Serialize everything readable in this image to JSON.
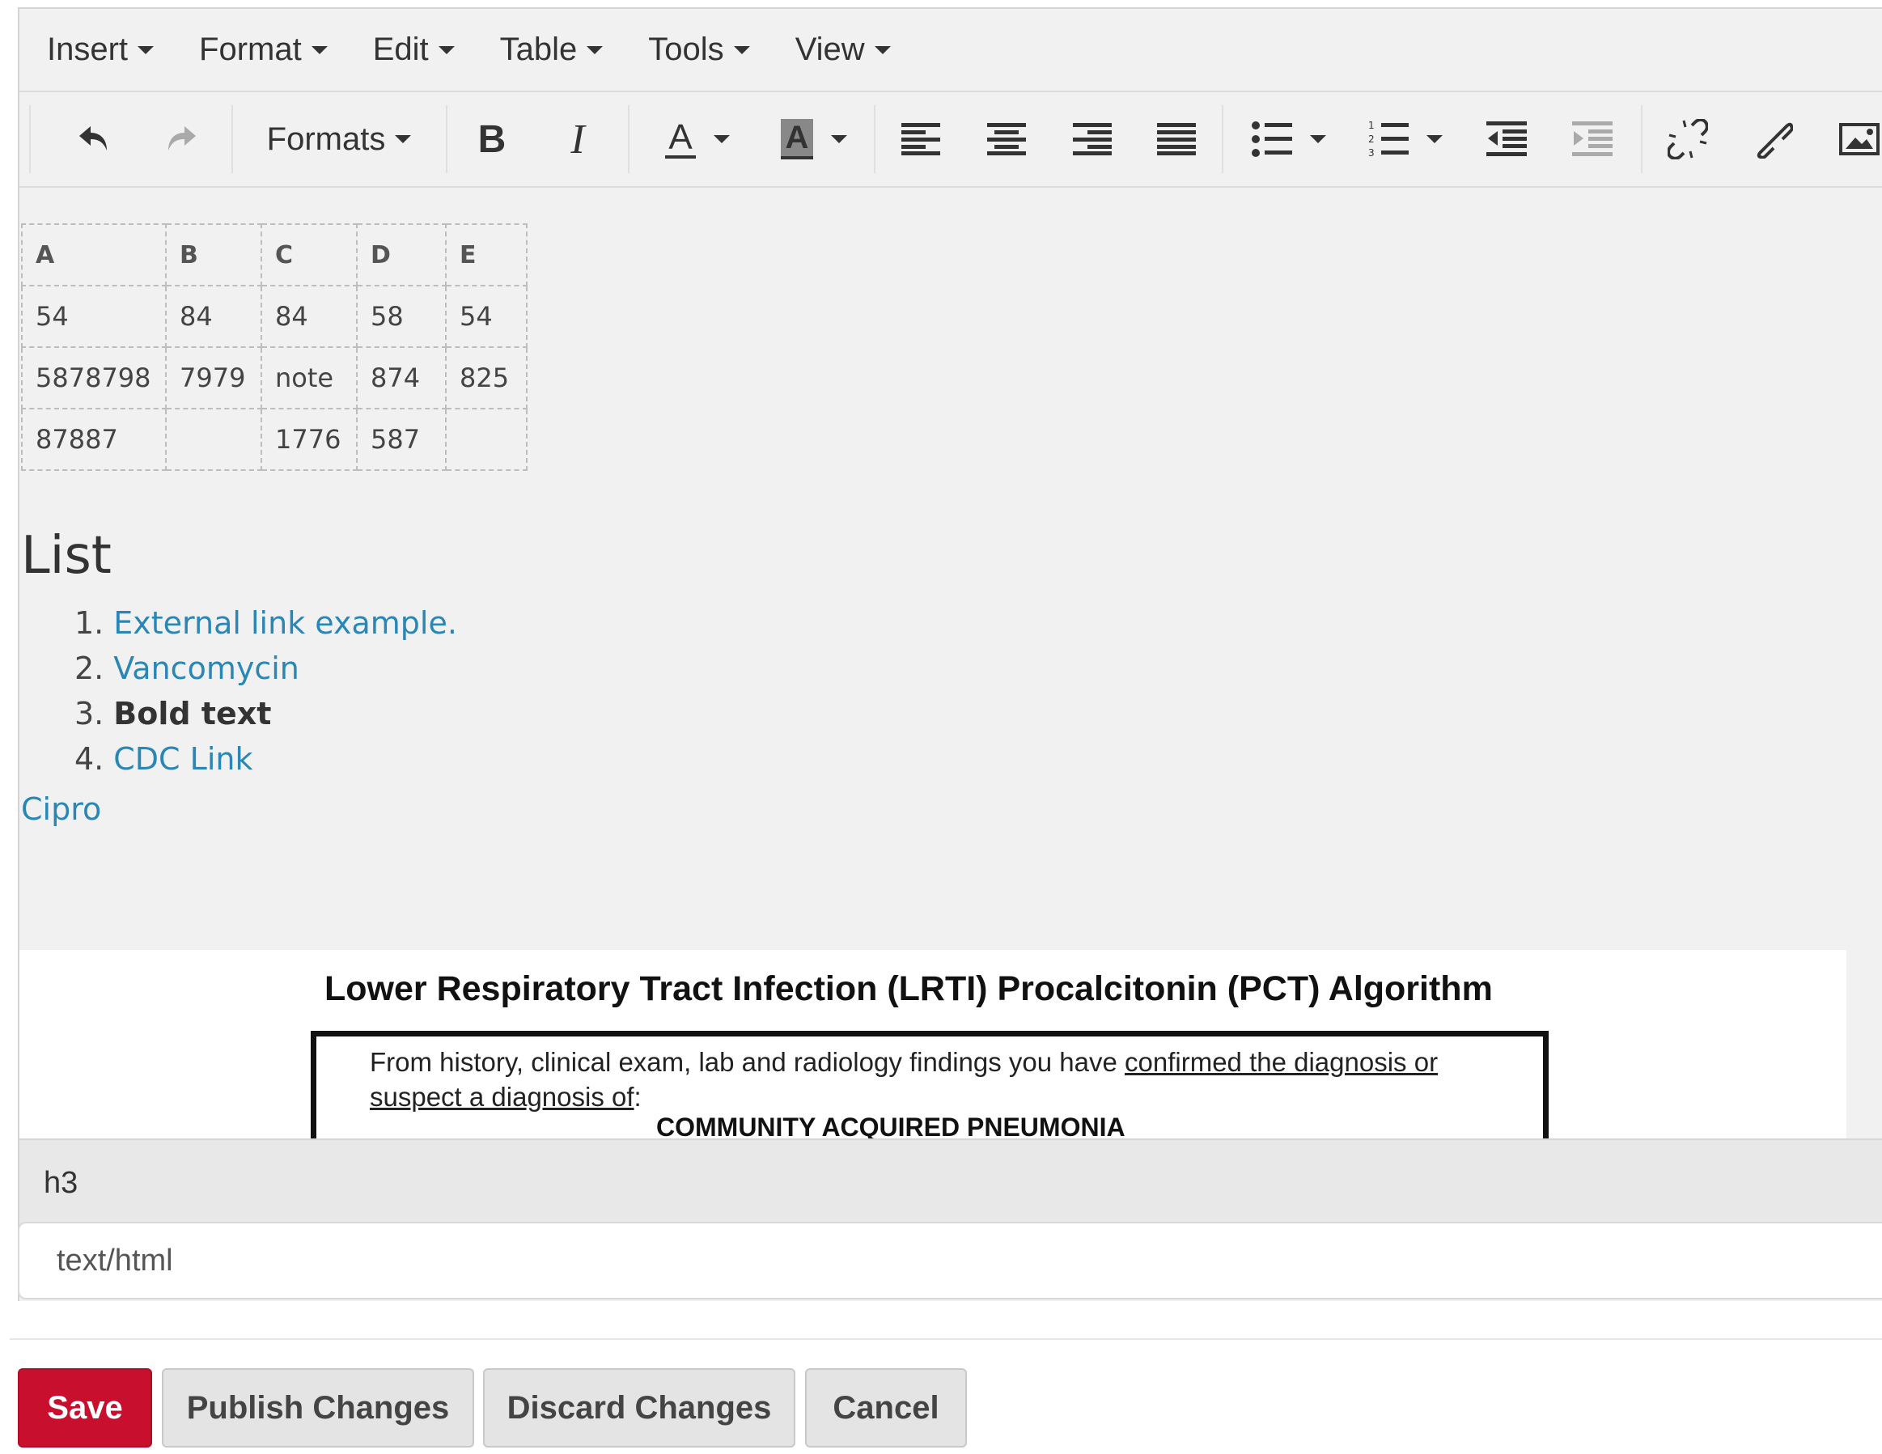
{
  "menubar": {
    "items": [
      {
        "label": "Insert"
      },
      {
        "label": "Format"
      },
      {
        "label": "Edit"
      },
      {
        "label": "Table"
      },
      {
        "label": "Tools"
      },
      {
        "label": "View"
      }
    ]
  },
  "toolbar": {
    "formats_label": "Formats",
    "bold_glyph": "B",
    "italic_glyph": "I",
    "text_color_glyph": "A",
    "bg_color_glyph": "A",
    "icons": [
      "undo-icon",
      "redo-icon",
      "bold-icon",
      "italic-icon",
      "text-color-icon",
      "background-color-icon",
      "align-left-icon",
      "align-center-icon",
      "align-right-icon",
      "align-justify-icon",
      "bullet-list-icon",
      "numbered-list-icon",
      "outdent-icon",
      "indent-icon",
      "unlink-icon",
      "link-icon",
      "image-icon"
    ]
  },
  "content": {
    "table": {
      "headers": [
        "A",
        "B",
        "C",
        "D",
        "E"
      ],
      "rows": [
        [
          "54",
          "84",
          "84",
          "58",
          "54"
        ],
        [
          "5878798",
          "7979",
          "note",
          "874",
          "825"
        ],
        [
          "87887",
          "",
          "1776",
          "587",
          ""
        ]
      ]
    },
    "list_heading": "List",
    "list": [
      {
        "num": "1.",
        "text": "External link example."
      },
      {
        "num": "2.",
        "text": "Vancomycin"
      },
      {
        "num": "3.",
        "text": "Bold text"
      },
      {
        "num": "4.",
        "text": "CDC Link"
      }
    ],
    "cipro_link": "Cipro",
    "embedded_image": {
      "title": "Lower Respiratory Tract Infection (LRTI) Procalcitonin (PCT) Algorithm",
      "text_plain": "From history, clinical exam, lab and radiology findings you have ",
      "text_underlined_1": "confirmed the diagnosis or",
      "text_underlined_2": "suspect a diagnosis of",
      "text_colon": ":",
      "subheading": "COMMUNITY ACQUIRED PNEUMONIA"
    }
  },
  "statusbar": {
    "path": "h3"
  },
  "mimetype": {
    "value": "text/html"
  },
  "actions": {
    "save": "Save",
    "publish": "Publish Changes",
    "discard": "Discard Changes",
    "cancel": "Cancel"
  },
  "colors": {
    "save_button": "#c8102e",
    "link": "#2a86b5",
    "editor_bg": "#f1f1f1"
  }
}
